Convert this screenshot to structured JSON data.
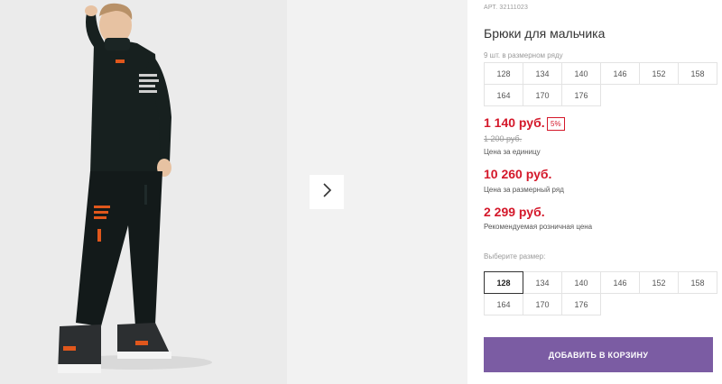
{
  "product": {
    "sku": "АРТ. 32111023",
    "title": "Брюки для мальчика"
  },
  "size_range": {
    "label": "9 шт. в размерном ряду",
    "sizes": [
      "128",
      "134",
      "140",
      "146",
      "152",
      "158",
      "164",
      "170",
      "176"
    ]
  },
  "prices": {
    "unit_price": "1 140 руб.",
    "discount_badge": "5%",
    "old_price": "1 200 руб.",
    "unit_caption": "Цена за единицу",
    "range_price": "10 260 руб.",
    "range_caption": "Цена за размерный ряд",
    "retail_price": "2 299 руб.",
    "retail_caption": "Рекомендуемая розничная цена"
  },
  "size_select": {
    "label": "Выберите размер:",
    "sizes": [
      "128",
      "134",
      "140",
      "146",
      "152",
      "158",
      "164",
      "170",
      "176"
    ],
    "selected": "128"
  },
  "cart": {
    "button_label": "ДОБАВИТЬ В КОРЗИНУ"
  },
  "colors": {
    "price_red": "#d4182a",
    "button_purple": "#7b5ca3"
  },
  "icons": {
    "next": "chevron-right-icon"
  }
}
